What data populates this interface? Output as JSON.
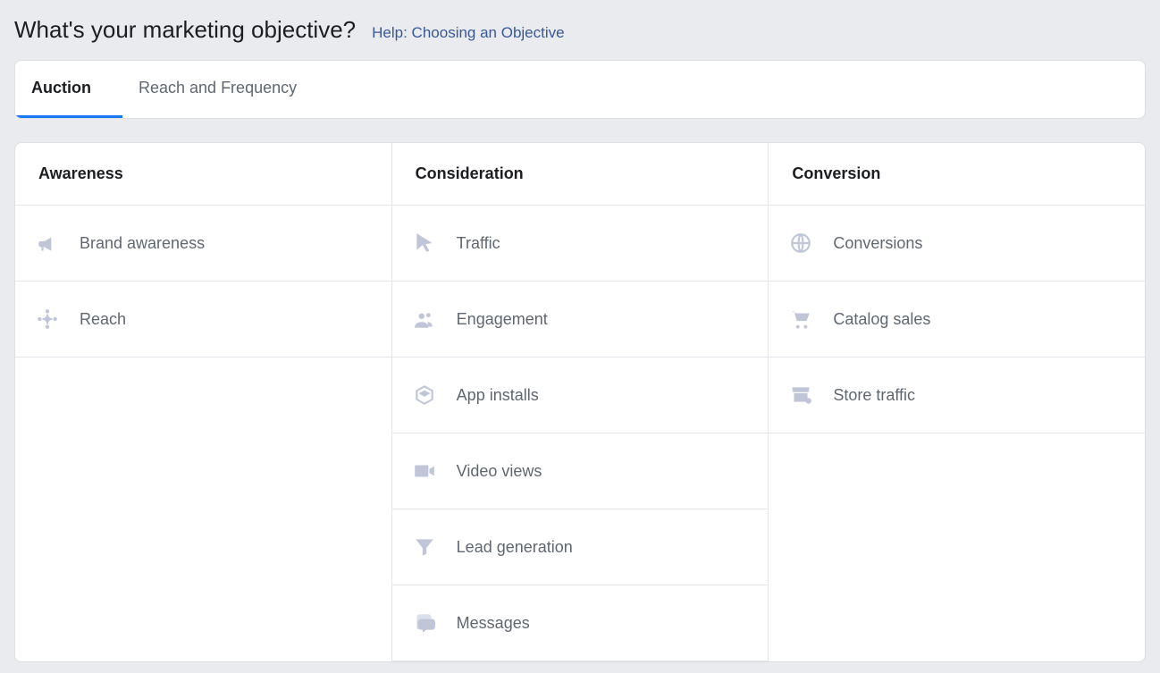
{
  "header": {
    "title": "What's your marketing objective?",
    "help_link": "Help: Choosing an Objective"
  },
  "tabs": {
    "auction": "Auction",
    "reach_frequency": "Reach and Frequency"
  },
  "columns": {
    "awareness": {
      "header": "Awareness",
      "items": {
        "brand_awareness": "Brand awareness",
        "reach": "Reach"
      }
    },
    "consideration": {
      "header": "Consideration",
      "items": {
        "traffic": "Traffic",
        "engagement": "Engagement",
        "app_installs": "App installs",
        "video_views": "Video views",
        "lead_generation": "Lead generation",
        "messages": "Messages"
      }
    },
    "conversion": {
      "header": "Conversion",
      "items": {
        "conversions": "Conversions",
        "catalog_sales": "Catalog sales",
        "store_traffic": "Store traffic"
      }
    }
  }
}
